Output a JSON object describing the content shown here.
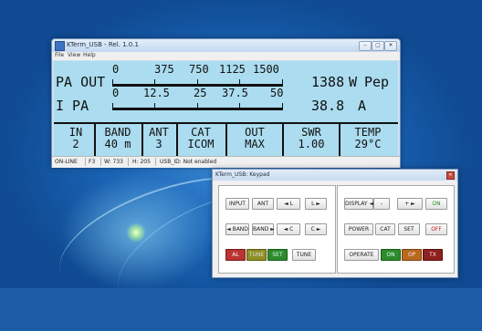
{
  "main_window": {
    "title": "KTerm_USB - Rel. 1.0.1",
    "menu": [
      "File",
      "View",
      "Help"
    ],
    "pa_out": {
      "label": "PA OUT",
      "scale": [
        "0",
        "375",
        "750",
        "1125",
        "1500"
      ],
      "value": "1388",
      "unit": "W",
      "mode": "Pep"
    },
    "i_pa": {
      "label": "I PA",
      "scale": [
        "0",
        "12.5",
        "25",
        "37.5",
        "50"
      ],
      "value": "38.8",
      "unit": "A"
    },
    "cells": [
      {
        "label": "IN",
        "value": "2"
      },
      {
        "label": "BAND",
        "value": "40 m"
      },
      {
        "label": "ANT",
        "value": "3"
      },
      {
        "label": "CAT",
        "value": "ICOM"
      },
      {
        "label": "OUT",
        "value": "MAX"
      },
      {
        "label": "SWR",
        "value": "1.00"
      },
      {
        "label": "TEMP",
        "value": "29°C"
      }
    ],
    "status": [
      "ON-LINE",
      "F3",
      "W: 733",
      "H: 205",
      "USB_ID: Not enabled"
    ]
  },
  "keypad_window": {
    "title": "KTerm_USB: Keypad",
    "left_panel": {
      "row1": [
        "INPUT",
        "ANT",
        "◄ L",
        "L ►"
      ],
      "row2": [
        "◄ BAND",
        "BAND ►",
        "◄ C",
        "C ►"
      ],
      "row3": [
        "AL",
        "TUNE",
        "SET",
        "TUNE"
      ]
    },
    "right_panel": {
      "row1": [
        "DISPLAY ◄",
        "-",
        "+ ►",
        "ON"
      ],
      "row2": [
        "POWER",
        "CAT",
        "SET",
        "OFF"
      ],
      "row3": [
        "OPERATE",
        "ON",
        "OP",
        "TX"
      ]
    }
  }
}
